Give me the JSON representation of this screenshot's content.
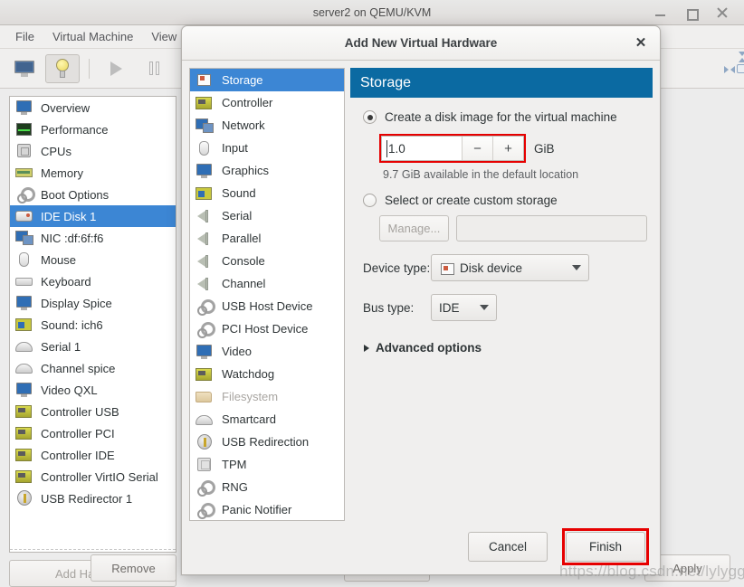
{
  "window": {
    "title": "server2 on QEMU/KVM",
    "controls": {
      "minimize": "minimize",
      "maximize": "maximize",
      "close": "close"
    },
    "menus": [
      "File",
      "Virtual Machine",
      "View"
    ],
    "toolbar": {
      "console_icon": "monitor-icon",
      "details_icon": "lightbulb-icon",
      "run_icon": "play-icon",
      "pause_icon": "pause-icon",
      "fullscreen_icon": "fullscreen-icon"
    },
    "hardware_list": [
      {
        "label": "Overview",
        "icon": "monitor-icon",
        "selected": false
      },
      {
        "label": "Performance",
        "icon": "performance-graph-icon",
        "selected": false
      },
      {
        "label": "CPUs",
        "icon": "cpu-chip-icon",
        "selected": false
      },
      {
        "label": "Memory",
        "icon": "memory-stick-icon",
        "selected": false
      },
      {
        "label": "Boot Options",
        "icon": "gears-icon",
        "selected": false
      },
      {
        "label": "IDE Disk 1",
        "icon": "disk-icon",
        "selected": true
      },
      {
        "label": "NIC :df:6f:f6",
        "icon": "network-icon",
        "selected": false
      },
      {
        "label": "Mouse",
        "icon": "mouse-icon",
        "selected": false
      },
      {
        "label": "Keyboard",
        "icon": "keyboard-icon",
        "selected": false
      },
      {
        "label": "Display Spice",
        "icon": "monitor-icon",
        "selected": false
      },
      {
        "label": "Sound: ich6",
        "icon": "sound-card-icon",
        "selected": false
      },
      {
        "label": "Serial 1",
        "icon": "serial-port-icon",
        "selected": false
      },
      {
        "label": "Channel spice",
        "icon": "serial-port-icon",
        "selected": false
      },
      {
        "label": "Video QXL",
        "icon": "monitor-icon",
        "selected": false
      },
      {
        "label": "Controller USB",
        "icon": "controller-card-icon",
        "selected": false
      },
      {
        "label": "Controller PCI",
        "icon": "controller-card-icon",
        "selected": false
      },
      {
        "label": "Controller IDE",
        "icon": "controller-card-icon",
        "selected": false
      },
      {
        "label": "Controller VirtIO Serial",
        "icon": "controller-card-icon",
        "selected": false
      },
      {
        "label": "USB Redirector 1",
        "icon": "usb-icon",
        "selected": false
      }
    ],
    "add_hardware_label": "Add Hardware",
    "footer_buttons": [
      {
        "label": "Remove",
        "name": "remove-button"
      },
      {
        "label": "Apply",
        "name": "apply-button"
      }
    ]
  },
  "dialog": {
    "title": "Add New Virtual Hardware",
    "close_glyph": "✕",
    "categories": [
      {
        "label": "Storage",
        "icon": "storage-icon",
        "selected": true,
        "disabled": false
      },
      {
        "label": "Controller",
        "icon": "controller-card-icon",
        "selected": false,
        "disabled": false
      },
      {
        "label": "Network",
        "icon": "network-icon",
        "selected": false,
        "disabled": false
      },
      {
        "label": "Input",
        "icon": "mouse-icon",
        "selected": false,
        "disabled": false
      },
      {
        "label": "Graphics",
        "icon": "monitor-icon",
        "selected": false,
        "disabled": false
      },
      {
        "label": "Sound",
        "icon": "sound-card-icon",
        "selected": false,
        "disabled": false
      },
      {
        "label": "Serial",
        "icon": "speaker-icon",
        "selected": false,
        "disabled": false
      },
      {
        "label": "Parallel",
        "icon": "speaker-icon",
        "selected": false,
        "disabled": false
      },
      {
        "label": "Console",
        "icon": "speaker-icon",
        "selected": false,
        "disabled": false
      },
      {
        "label": "Channel",
        "icon": "speaker-icon",
        "selected": false,
        "disabled": false
      },
      {
        "label": "USB Host Device",
        "icon": "gears-icon",
        "selected": false,
        "disabled": false
      },
      {
        "label": "PCI Host Device",
        "icon": "gears-icon",
        "selected": false,
        "disabled": false
      },
      {
        "label": "Video",
        "icon": "monitor-icon",
        "selected": false,
        "disabled": false
      },
      {
        "label": "Watchdog",
        "icon": "controller-card-icon",
        "selected": false,
        "disabled": false
      },
      {
        "label": "Filesystem",
        "icon": "folder-icon",
        "selected": false,
        "disabled": true
      },
      {
        "label": "Smartcard",
        "icon": "serial-port-icon",
        "selected": false,
        "disabled": false
      },
      {
        "label": "USB Redirection",
        "icon": "usb-icon",
        "selected": false,
        "disabled": false
      },
      {
        "label": "TPM",
        "icon": "tpm-chip-icon",
        "selected": false,
        "disabled": false
      },
      {
        "label": "RNG",
        "icon": "gears-icon",
        "selected": false,
        "disabled": false
      },
      {
        "label": "Panic Notifier",
        "icon": "gears-icon",
        "selected": false,
        "disabled": false
      }
    ],
    "pane": {
      "header": "Storage",
      "header_color": "#0b6aa2",
      "create_disk": {
        "label": "Create a disk image for the virtual machine",
        "selected": true,
        "size_value": "1.0",
        "size_unit": "GiB",
        "decrement_glyph": "−",
        "increment_glyph": "+",
        "available_text": "9.7 GiB available in the default location",
        "highlight_color": "#e60000"
      },
      "custom_storage": {
        "label": "Select or create custom storage",
        "selected": false,
        "manage_label": "Manage...",
        "path_value": "",
        "path_placeholder": ""
      },
      "device_type": {
        "label": "Device type:",
        "value": "Disk device",
        "icon": "storage-icon"
      },
      "bus_type": {
        "label": "Bus type:",
        "value": "IDE"
      },
      "advanced": {
        "label": "Advanced options",
        "expanded": false
      }
    },
    "footer": {
      "cancel_label": "Cancel",
      "finish_label": "Finish",
      "finish_highlight_color": "#e60000"
    }
  },
  "watermark": {
    "text": "https://blog.csdn.net/lylygg"
  }
}
